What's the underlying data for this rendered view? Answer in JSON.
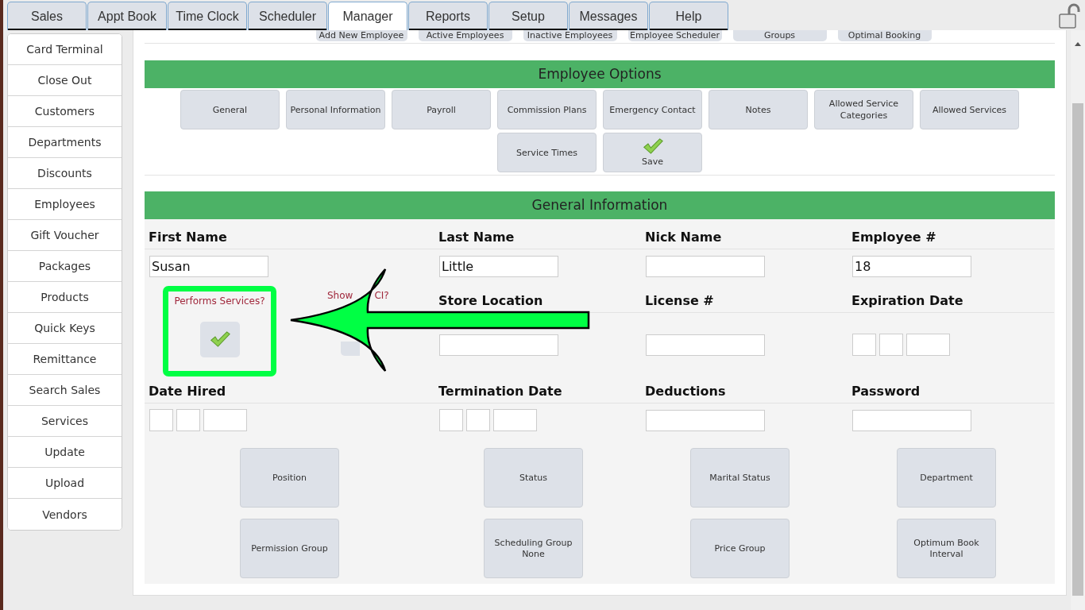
{
  "tabs": [
    {
      "label": "Sales",
      "selected": false
    },
    {
      "label": "Appt Book",
      "selected": false
    },
    {
      "label": "Time Clock",
      "selected": false
    },
    {
      "label": "Scheduler",
      "selected": false
    },
    {
      "label": "Manager",
      "selected": true
    },
    {
      "label": "Reports",
      "selected": false
    },
    {
      "label": "Setup",
      "selected": false
    },
    {
      "label": "Messages",
      "selected": false
    },
    {
      "label": "Help",
      "selected": false
    }
  ],
  "sidebar": {
    "items": [
      "Card Terminal",
      "Close Out",
      "Customers",
      "Departments",
      "Discounts",
      "Employees",
      "Gift Voucher",
      "Packages",
      "Products",
      "Quick Keys",
      "Remittance",
      "Search Sales",
      "Services",
      "Update",
      "Upload",
      "Vendors"
    ]
  },
  "subnav": [
    "Add New Employee",
    "Active Employees",
    "Inactive Employees",
    "Employee Scheduler",
    "Groups",
    "Optimal Booking"
  ],
  "employee_options": {
    "title": "Employee Options",
    "buttons": [
      {
        "kind": "text",
        "lines": [
          "General"
        ]
      },
      {
        "kind": "text",
        "lines": [
          "Personal Information"
        ]
      },
      {
        "kind": "text",
        "lines": [
          "Payroll"
        ]
      },
      {
        "kind": "text",
        "lines": [
          "Commission Plans"
        ]
      },
      {
        "kind": "text",
        "lines": [
          "Emergency Contact"
        ]
      },
      {
        "kind": "text",
        "lines": [
          "Notes"
        ]
      },
      {
        "kind": "text",
        "lines": [
          "Allowed Service",
          "Categories"
        ]
      },
      {
        "kind": "text",
        "lines": [
          "Allowed Services"
        ]
      },
      {
        "kind": "text",
        "lines": [
          "Service Times"
        ]
      },
      {
        "kind": "save",
        "lines": [
          "Save"
        ]
      }
    ]
  },
  "general_information": {
    "title": "General Information",
    "rows": [
      {
        "fields": [
          {
            "kind": "text",
            "label": "First Name",
            "value": "Susan"
          },
          {
            "kind": "text",
            "label": "Last Name",
            "value": "Little"
          },
          {
            "kind": "text",
            "label": "Nick Name"
          },
          {
            "kind": "text",
            "label": "Employee #",
            "value": "18"
          }
        ]
      },
      {
        "fields": [
          {
            "kind": "toggles",
            "items": [
              {
                "label_parts": [
                  "Performs Services?"
                ],
                "checked": true,
                "highlighted": true
              },
              {
                "label_parts": [
                  "Show",
                  "CI?"
                ],
                "checked": false,
                "highlighted": false
              }
            ]
          },
          {
            "kind": "text",
            "label": "Store Location"
          },
          {
            "kind": "text",
            "label": "License #"
          },
          {
            "kind": "date",
            "label": "Expiration Date"
          }
        ]
      },
      {
        "fields": [
          {
            "kind": "date",
            "label": "Date Hired"
          },
          {
            "kind": "date",
            "label": "Termination Date"
          },
          {
            "kind": "text",
            "label": "Deductions"
          },
          {
            "kind": "text",
            "label": "Password"
          }
        ]
      }
    ],
    "buttons": [
      [
        "Position"
      ],
      [
        "Status"
      ],
      [
        "Marital Status"
      ],
      [
        "Department"
      ],
      [
        "Permission Group"
      ],
      [
        "Scheduling Group",
        "None"
      ],
      [
        "Price Group"
      ],
      [
        "Optimum Book",
        "Interval"
      ]
    ]
  }
}
